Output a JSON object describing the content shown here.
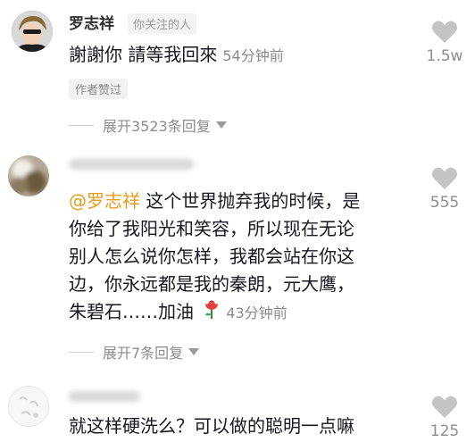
{
  "comments": [
    {
      "username": "罗志祥",
      "follow_badge": "你关注的人",
      "text": "謝謝你 請等我回來",
      "time": "54分钟前",
      "author_liked": "作者赞过",
      "likes": "1.5w",
      "expand_label": "展开3523条回复"
    },
    {
      "mention": "@罗志祥",
      "text_after_mention": " 这个世界抛弃我的时候，是",
      "lines": [
        "你给了我阳光和笑容，所以现在无论",
        "别人怎么说你怎样，我都会站在你这",
        "边，你永远都是我的秦朗，元大鹰，",
        "朱碧石……加油"
      ],
      "emoji": "rose",
      "time": "43分钟前",
      "likes": "555",
      "expand_label": "展开7条回复"
    },
    {
      "text": "就这样硬洗么？可以做的聪明一点嘛",
      "likes": "125"
    }
  ],
  "colors": {
    "mention": "#e79c1c",
    "like_icon": "#c4c4c4"
  }
}
